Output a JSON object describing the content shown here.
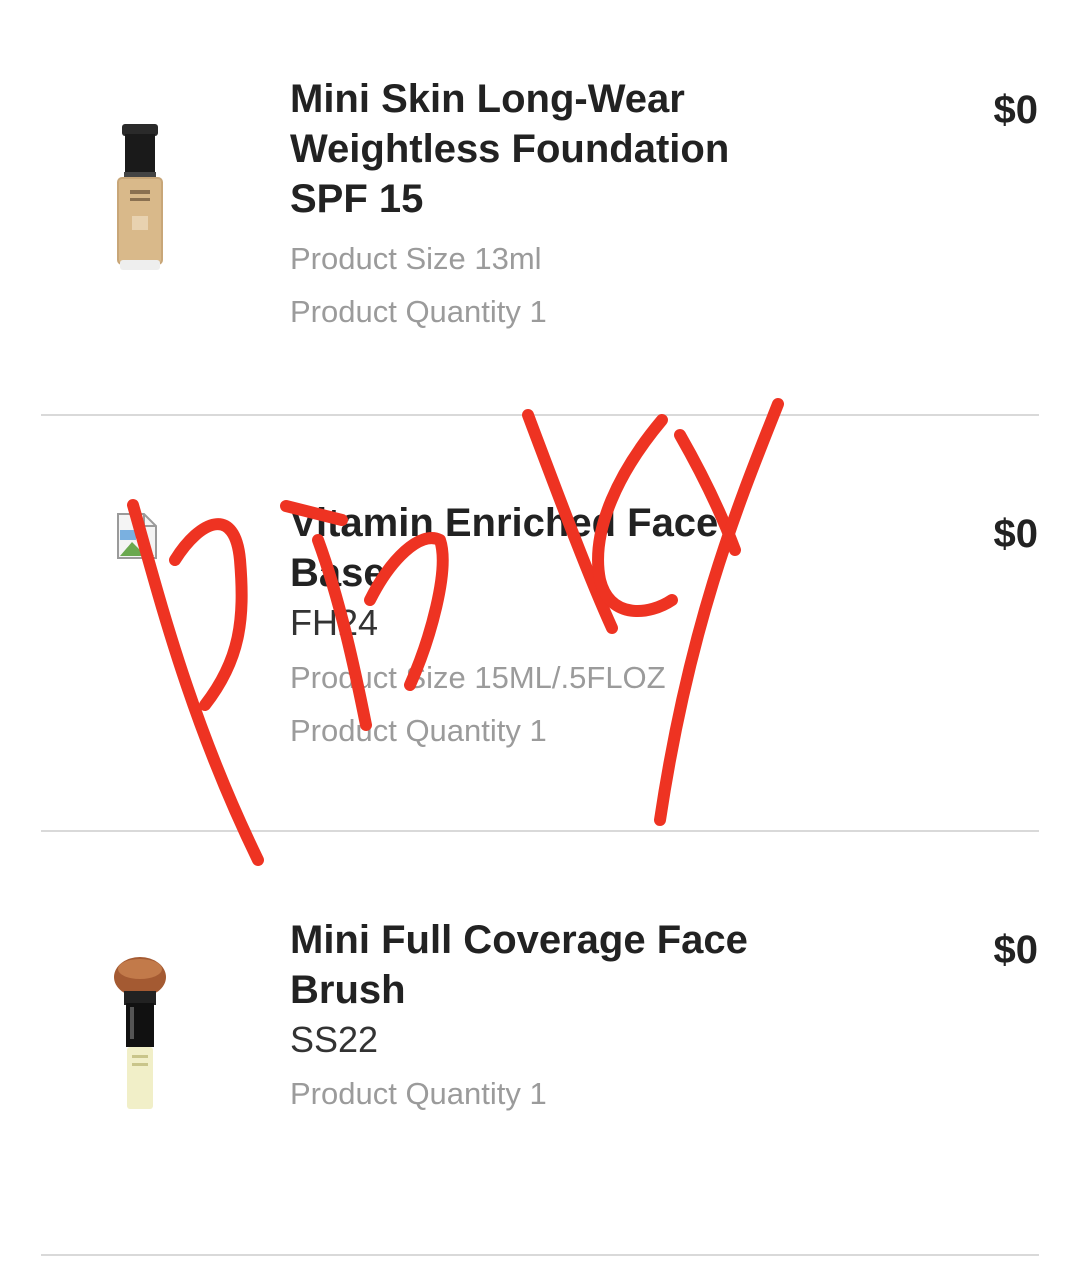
{
  "items": [
    {
      "name": "Mini Skin Long-Wear Weightless Foundation SPF 15",
      "code": "",
      "size": "Product Size 13ml",
      "quantity": "Product Quantity 1",
      "price": "$0",
      "image": "foundation-bottle"
    },
    {
      "name": "Vitamin Enriched Face Base",
      "code": "FH24",
      "size": "Product Size 15ML/.5FLOZ",
      "quantity": "Product Quantity 1",
      "price": "$0",
      "image": "broken-image"
    },
    {
      "name": "Mini Full Coverage Face Brush",
      "code": "SS22",
      "size": "",
      "quantity": "Product Quantity 1",
      "price": "$0",
      "image": "face-brush"
    }
  ],
  "annotation": {
    "handwritten_text": "pinky",
    "color": "#ee3322"
  },
  "colors": {
    "primary_text": "#222222",
    "secondary_text": "#9b9b9b",
    "divider": "#d9d9d9"
  }
}
